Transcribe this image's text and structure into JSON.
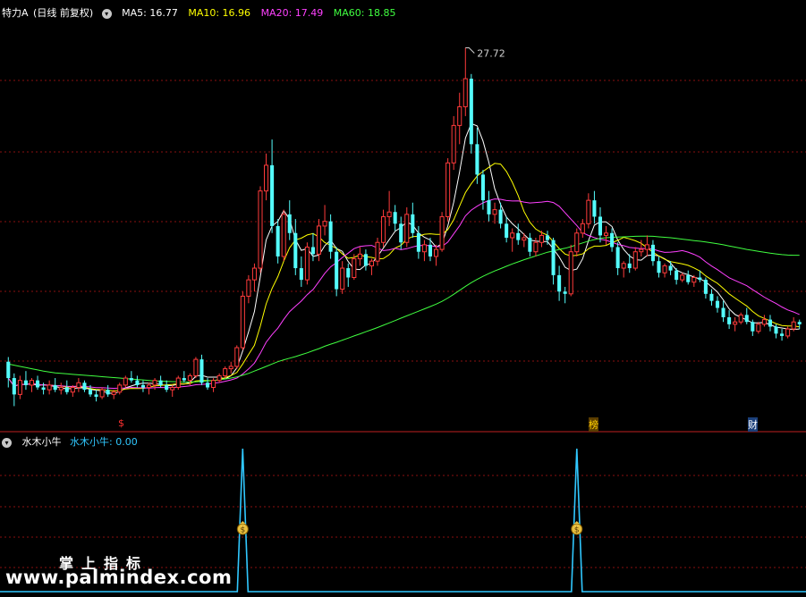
{
  "header": {
    "stock_name": "特力A",
    "period": "(日线 前复权)",
    "ma5": "MA5: 16.77",
    "ma10": "MA10: 16.96",
    "ma20": "MA20: 17.49",
    "ma60": "MA60: 18.85",
    "colors": {
      "ma5": "#ffffff",
      "ma10": "#ffff00",
      "ma20": "#ff40ff",
      "ma60": "#40ff40"
    }
  },
  "indicator_header": {
    "name": "水木小牛",
    "value_label": "水木小牛: 0.00"
  },
  "markers": {
    "dollar": "$",
    "bang": "榜",
    "cai": "财"
  },
  "watermark": {
    "line1": "掌上指标",
    "line2": "www.palmindex.com"
  },
  "chart_data": [
    {
      "type": "candlestick",
      "title": "特力A (日线 前复权)",
      "annotation": {
        "text": "27.72",
        "label": "high"
      },
      "y_range_price": [
        11.5,
        29.0
      ],
      "candles_ohlc": [
        [
          14.3,
          14.5,
          13.2,
          13.6
        ],
        [
          13.6,
          13.8,
          12.4,
          12.9
        ],
        [
          12.9,
          13.7,
          12.7,
          13.5
        ],
        [
          13.5,
          13.9,
          13.1,
          13.3
        ],
        [
          13.3,
          13.6,
          13.0,
          13.5
        ],
        [
          13.5,
          13.7,
          13.1,
          13.2
        ],
        [
          13.2,
          13.4,
          12.9,
          13.1
        ],
        [
          13.1,
          13.5,
          12.9,
          13.3
        ],
        [
          13.3,
          13.6,
          13.0,
          13.1
        ],
        [
          13.1,
          13.4,
          12.9,
          13.2
        ],
        [
          13.2,
          13.5,
          12.9,
          13.0
        ],
        [
          13.0,
          13.3,
          12.8,
          13.2
        ],
        [
          13.2,
          13.6,
          13.0,
          13.4
        ],
        [
          13.4,
          13.5,
          13.0,
          13.1
        ],
        [
          13.1,
          13.3,
          12.8,
          12.9
        ],
        [
          12.9,
          13.1,
          12.6,
          12.8
        ],
        [
          12.8,
          13.2,
          12.7,
          13.1
        ],
        [
          13.1,
          13.3,
          12.8,
          12.9
        ],
        [
          12.9,
          13.1,
          12.7,
          13.0
        ],
        [
          13.0,
          13.4,
          12.9,
          13.3
        ],
        [
          13.3,
          13.7,
          13.2,
          13.6
        ],
        [
          13.6,
          13.9,
          13.4,
          13.5
        ],
        [
          13.5,
          13.7,
          13.2,
          13.3
        ],
        [
          13.3,
          13.5,
          13.0,
          13.2
        ],
        [
          13.2,
          13.4,
          12.9,
          13.3
        ],
        [
          13.3,
          13.6,
          13.1,
          13.5
        ],
        [
          13.5,
          13.7,
          13.2,
          13.3
        ],
        [
          13.3,
          13.5,
          13.0,
          13.1
        ],
        [
          13.1,
          13.3,
          12.8,
          13.2
        ],
        [
          13.2,
          13.7,
          13.1,
          13.6
        ],
        [
          13.6,
          13.9,
          13.4,
          13.5
        ],
        [
          13.5,
          13.8,
          13.3,
          13.7
        ],
        [
          13.7,
          14.5,
          13.6,
          14.4
        ],
        [
          14.4,
          14.6,
          13.3,
          13.4
        ],
        [
          13.4,
          13.6,
          13.1,
          13.2
        ],
        [
          13.2,
          13.6,
          13.0,
          13.5
        ],
        [
          13.5,
          13.8,
          13.4,
          13.7
        ],
        [
          13.7,
          14.1,
          13.6,
          14.0
        ],
        [
          14.0,
          14.3,
          13.8,
          14.1
        ],
        [
          14.1,
          15.0,
          14.0,
          14.9
        ],
        [
          14.9,
          17.3,
          14.8,
          17.1
        ],
        [
          17.1,
          18.0,
          16.8,
          17.8
        ],
        [
          17.8,
          18.5,
          17.3,
          18.3
        ],
        [
          18.3,
          21.8,
          18.1,
          21.6
        ],
        [
          21.6,
          23.2,
          21.2,
          22.7
        ],
        [
          22.7,
          23.8,
          19.8,
          20.1
        ],
        [
          20.1,
          20.4,
          18.5,
          18.8
        ],
        [
          18.8,
          20.8,
          18.6,
          20.6
        ],
        [
          20.6,
          21.2,
          19.5,
          19.8
        ],
        [
          19.8,
          20.4,
          18.0,
          18.3
        ],
        [
          18.3,
          18.8,
          17.5,
          17.8
        ],
        [
          17.8,
          19.4,
          17.6,
          19.2
        ],
        [
          19.2,
          19.8,
          18.6,
          18.9
        ],
        [
          18.9,
          20.4,
          18.6,
          20.1
        ],
        [
          20.1,
          21.0,
          19.7,
          20.3
        ],
        [
          20.3,
          20.6,
          18.7,
          19.0
        ],
        [
          19.0,
          19.2,
          17.1,
          17.4
        ],
        [
          17.4,
          18.6,
          17.2,
          18.3
        ],
        [
          18.3,
          18.5,
          17.5,
          17.9
        ],
        [
          17.9,
          18.9,
          17.8,
          18.7
        ],
        [
          18.7,
          19.2,
          18.4,
          18.9
        ],
        [
          18.9,
          19.1,
          18.2,
          18.4
        ],
        [
          18.4,
          18.7,
          18.0,
          18.6
        ],
        [
          18.6,
          19.6,
          18.4,
          19.4
        ],
        [
          19.4,
          20.8,
          19.2,
          20.5
        ],
        [
          20.5,
          21.6,
          20.1,
          20.7
        ],
        [
          20.7,
          21.0,
          19.9,
          20.2
        ],
        [
          20.2,
          20.5,
          19.1,
          19.4
        ],
        [
          19.4,
          20.9,
          19.2,
          20.6
        ],
        [
          20.6,
          21.1,
          19.6,
          19.8
        ],
        [
          19.8,
          20.1,
          18.7,
          19.0
        ],
        [
          19.0,
          19.5,
          18.6,
          19.3
        ],
        [
          19.3,
          19.6,
          18.6,
          18.8
        ],
        [
          18.8,
          19.3,
          18.4,
          19.1
        ],
        [
          19.1,
          20.7,
          19.0,
          20.5
        ],
        [
          20.5,
          23.0,
          20.3,
          22.8
        ],
        [
          22.8,
          24.8,
          22.5,
          24.4
        ],
        [
          24.4,
          25.8,
          23.6,
          25.2
        ],
        [
          25.2,
          27.72,
          24.8,
          26.4
        ],
        [
          26.4,
          26.6,
          23.2,
          23.6
        ],
        [
          23.6,
          24.3,
          21.9,
          22.3
        ],
        [
          22.3,
          22.5,
          20.8,
          21.2
        ],
        [
          21.2,
          21.6,
          20.3,
          20.6
        ],
        [
          20.6,
          21.1,
          20.2,
          20.8
        ],
        [
          20.8,
          21.1,
          20.0,
          20.2
        ],
        [
          20.2,
          20.5,
          19.4,
          19.6
        ],
        [
          19.6,
          20.0,
          19.0,
          19.8
        ],
        [
          19.8,
          20.2,
          19.3,
          19.5
        ],
        [
          19.5,
          19.8,
          19.2,
          19.6
        ],
        [
          19.6,
          19.8,
          18.8,
          19.0
        ],
        [
          19.0,
          19.6,
          18.8,
          19.4
        ],
        [
          19.4,
          19.9,
          19.2,
          19.7
        ],
        [
          19.7,
          19.9,
          19.3,
          19.5
        ],
        [
          19.5,
          19.6,
          17.6,
          18.0
        ],
        [
          18.0,
          18.4,
          16.9,
          17.3
        ],
        [
          17.3,
          17.5,
          16.8,
          17.2
        ],
        [
          17.2,
          19.3,
          17.1,
          19.0
        ],
        [
          19.0,
          20.0,
          18.8,
          19.8
        ],
        [
          19.8,
          20.4,
          19.6,
          20.2
        ],
        [
          20.2,
          21.5,
          20.0,
          21.2
        ],
        [
          21.2,
          21.6,
          20.2,
          20.5
        ],
        [
          20.5,
          20.9,
          19.4,
          19.7
        ],
        [
          19.7,
          20.1,
          19.3,
          19.8
        ],
        [
          19.8,
          20.0,
          19.0,
          19.2
        ],
        [
          19.2,
          19.4,
          18.0,
          18.3
        ],
        [
          18.3,
          18.6,
          17.9,
          18.5
        ],
        [
          18.5,
          18.9,
          18.1,
          18.3
        ],
        [
          18.3,
          19.2,
          18.2,
          19.0
        ],
        [
          19.0,
          19.5,
          18.8,
          19.1
        ],
        [
          19.1,
          19.7,
          18.8,
          19.3
        ],
        [
          19.3,
          19.5,
          18.4,
          18.6
        ],
        [
          18.6,
          18.8,
          17.9,
          18.1
        ],
        [
          18.1,
          18.5,
          17.9,
          18.4
        ],
        [
          18.4,
          18.6,
          18.0,
          18.2
        ],
        [
          18.2,
          18.3,
          17.6,
          17.8
        ],
        [
          17.8,
          18.1,
          17.7,
          18.0
        ],
        [
          18.0,
          18.2,
          17.6,
          17.7
        ],
        [
          17.7,
          18.0,
          17.5,
          17.9
        ],
        [
          17.9,
          18.2,
          17.7,
          17.8
        ],
        [
          17.8,
          17.9,
          17.0,
          17.2
        ],
        [
          17.2,
          17.4,
          16.7,
          16.9
        ],
        [
          16.9,
          17.1,
          16.4,
          16.6
        ],
        [
          16.6,
          16.9,
          16.0,
          16.2
        ],
        [
          16.2,
          16.5,
          15.7,
          15.9
        ],
        [
          15.9,
          16.2,
          15.6,
          16.0
        ],
        [
          16.0,
          16.4,
          15.9,
          16.3
        ],
        [
          16.3,
          16.6,
          15.9,
          16.0
        ],
        [
          16.0,
          16.1,
          15.4,
          15.6
        ],
        [
          15.6,
          16.0,
          15.5,
          15.9
        ],
        [
          15.9,
          16.3,
          15.8,
          16.1
        ],
        [
          16.1,
          16.3,
          15.6,
          15.8
        ],
        [
          15.8,
          15.9,
          15.3,
          15.5
        ],
        [
          15.5,
          15.7,
          15.2,
          15.4
        ],
        [
          15.4,
          15.8,
          15.3,
          15.7
        ],
        [
          15.7,
          16.2,
          15.6,
          16.0
        ],
        [
          16.0,
          16.1,
          15.7,
          15.9
        ]
      ],
      "series": [
        {
          "name": "MA5",
          "color": "#ffffff"
        },
        {
          "name": "MA10",
          "color": "#ffff00"
        },
        {
          "name": "MA20",
          "color": "#ff40ff"
        },
        {
          "name": "MA60",
          "color": "#40ff40"
        }
      ],
      "ma60_values": [
        14.2,
        14.15,
        14.1,
        14.05,
        14.0,
        13.95,
        13.9,
        13.86,
        13.82,
        13.8,
        13.78,
        13.76,
        13.74,
        13.72,
        13.7,
        13.68,
        13.66,
        13.64,
        13.62,
        13.6,
        13.58,
        13.56,
        13.54,
        13.52,
        13.5,
        13.48,
        13.47,
        13.46,
        13.45,
        13.44,
        13.43,
        13.43,
        13.44,
        13.46,
        13.48,
        13.5,
        13.53,
        13.56,
        13.6,
        13.65,
        13.72,
        13.8,
        13.9,
        14.0,
        14.1,
        14.2,
        14.3,
        14.38,
        14.45,
        14.52,
        14.6,
        14.68,
        14.77,
        14.86,
        14.96,
        15.05,
        15.13,
        15.22,
        15.31,
        15.4,
        15.49,
        15.58,
        15.67,
        15.76,
        15.86,
        15.96,
        16.06,
        16.16,
        16.26,
        16.36,
        16.46,
        16.56,
        16.66,
        16.76,
        16.88,
        17.02,
        17.18,
        17.35,
        17.52,
        17.68,
        17.82,
        17.95,
        18.07,
        18.18,
        18.28,
        18.38,
        18.48,
        18.57,
        18.66,
        18.74,
        18.82,
        18.9,
        18.98,
        19.04,
        19.1,
        19.15,
        19.22,
        19.3,
        19.38,
        19.46,
        19.52,
        19.57,
        19.6,
        19.62,
        19.63,
        19.64,
        19.65,
        19.66,
        19.67,
        19.67,
        19.66,
        19.64,
        19.62,
        19.6,
        19.57,
        19.54,
        19.51,
        19.48,
        19.45,
        19.42,
        19.38,
        19.34,
        19.3,
        19.25,
        19.2,
        19.15,
        19.1,
        19.06,
        19.02,
        18.98,
        18.94,
        18.91,
        18.88,
        18.86,
        18.85,
        18.85
      ]
    },
    {
      "type": "line",
      "title": "水木小牛",
      "series": [
        {
          "name": "水木小牛",
          "color": "#30c8ff"
        }
      ],
      "y_range": [
        0,
        1
      ],
      "spike_bar_indices": [
        40,
        97
      ],
      "current_value": 0.0,
      "icon": "money-bag-icon"
    }
  ]
}
